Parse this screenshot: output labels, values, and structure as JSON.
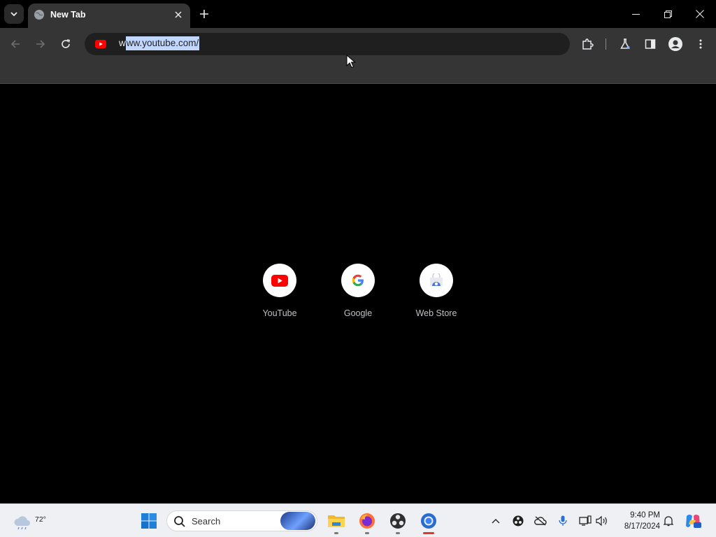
{
  "browser": {
    "tab": {
      "title": "New Tab"
    },
    "omnibox": {
      "url_prefix": "w",
      "url_selected": "ww.youtube.com/"
    }
  },
  "shortcuts": [
    {
      "label": "YouTube",
      "icon": "youtube-icon"
    },
    {
      "label": "Google",
      "icon": "google-icon"
    },
    {
      "label": "Web Store",
      "icon": "web-store-icon"
    }
  ],
  "taskbar": {
    "weather_temp": "72°",
    "search_placeholder": "Search",
    "time": "9:40 PM",
    "date": "8/17/2024"
  },
  "colors": {
    "tab_bg": "#353535",
    "toolbar_bg": "#353535",
    "omnibox_bg": "#1f1f1f",
    "selection": "#c2d7ff",
    "youtube_red": "#ff0000",
    "taskbar_bg": "#eef0f4"
  }
}
